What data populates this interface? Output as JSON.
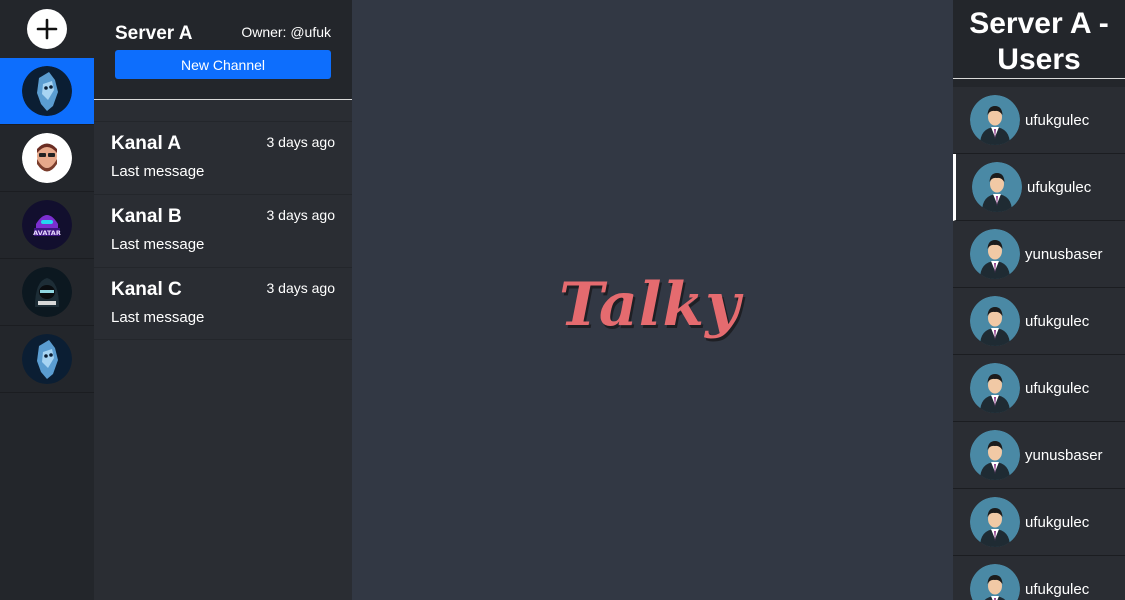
{
  "rail": {
    "servers": [
      {
        "name": "blue-shark-avatar",
        "active": true
      },
      {
        "name": "bearded-man-avatar",
        "active": false
      },
      {
        "name": "purple-avatar-logo",
        "active": false
      },
      {
        "name": "hooded-gamer-avatar",
        "active": false
      },
      {
        "name": "blue-shark-avatar",
        "active": false
      }
    ]
  },
  "server": {
    "name": "Server A",
    "owner": "Owner: @ufuk",
    "new_channel_label": "New Channel"
  },
  "channels": [
    {
      "name": "Kanal A",
      "time": "3 days ago",
      "last": "Last message"
    },
    {
      "name": "Kanal B",
      "time": "3 days ago",
      "last": "Last message"
    },
    {
      "name": "Kanal C",
      "time": "3 days ago",
      "last": "Last message"
    }
  ],
  "brand": {
    "logo_text": "Talky",
    "color": "#e56b6f"
  },
  "users": {
    "title": "Server A - Users",
    "list": [
      "ufukgulec",
      "ufukgulec",
      "yunusbaser",
      "ufukgulec",
      "ufukgulec",
      "yunusbaser",
      "ufukgulec",
      "ufukgulec"
    ]
  },
  "colors": {
    "accent": "#0d6efd",
    "background": "#323844",
    "panel": "#2a2d33",
    "rail": "#23262b"
  }
}
